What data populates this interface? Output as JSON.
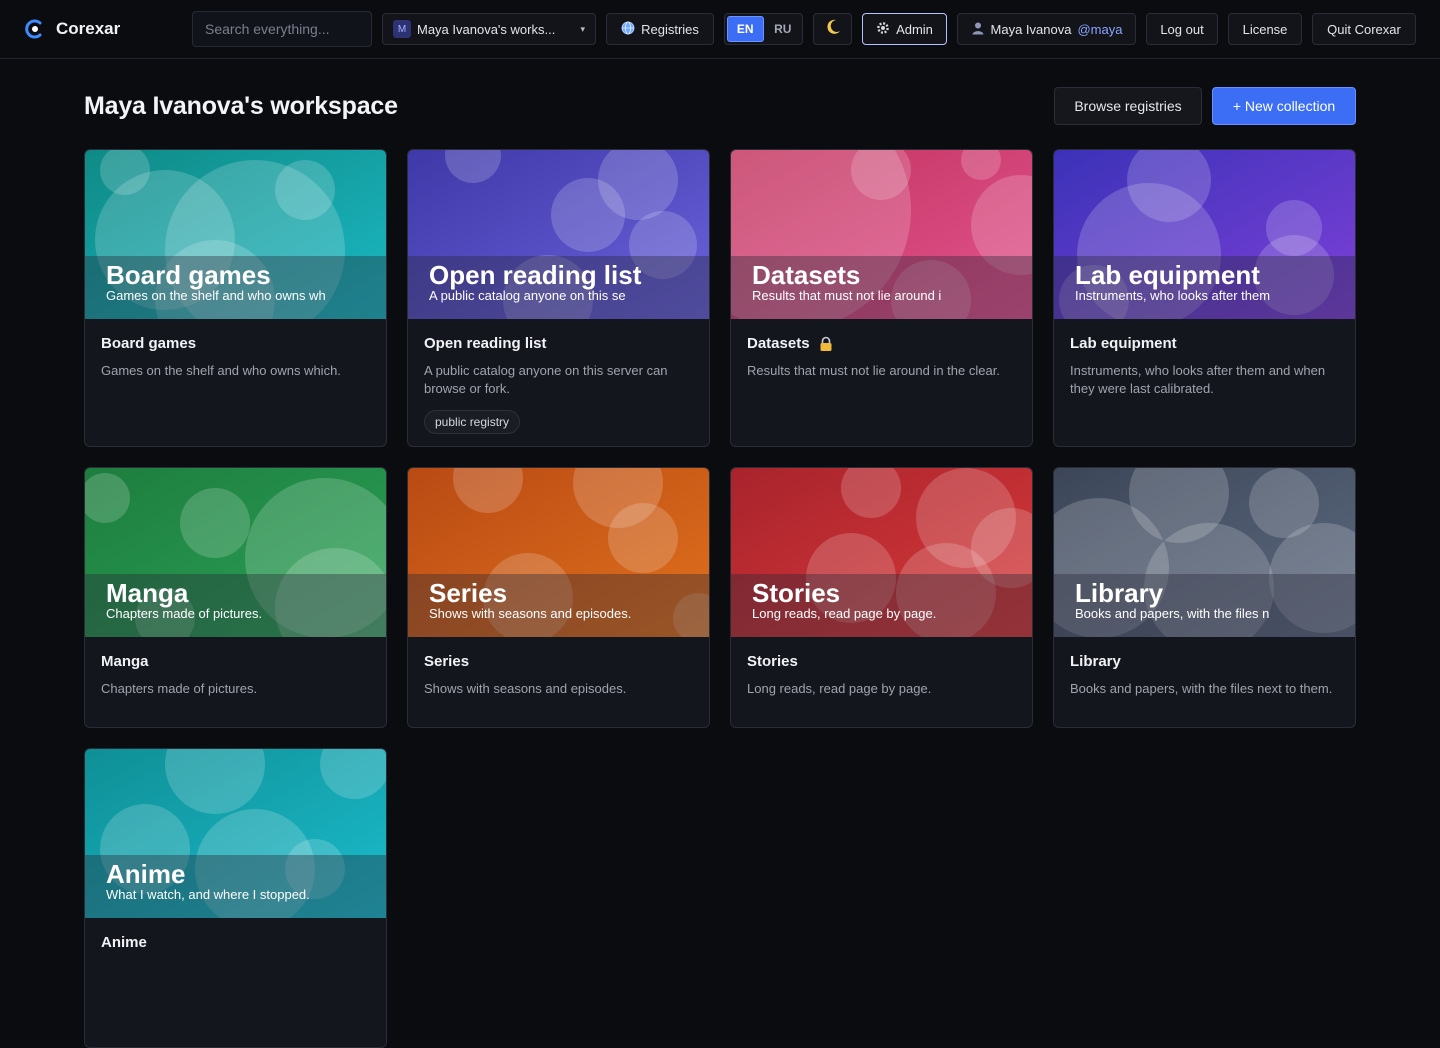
{
  "app": {
    "name": "Corexar"
  },
  "header": {
    "search_placeholder": "Search everything...",
    "workspace": {
      "avatar_letter": "M",
      "label": "Maya Ivanova's works..."
    },
    "registries_label": "Registries",
    "languages": [
      {
        "code": "EN",
        "active": true
      },
      {
        "code": "RU",
        "active": false
      }
    ],
    "theme_icon": "moon-icon",
    "admin_label": "Admin",
    "user": {
      "name": "Maya Ivanova",
      "handle": "@maya"
    },
    "logout_label": "Log out",
    "license_label": "License",
    "quit_label": "Quit Corexar"
  },
  "page": {
    "title": "Maya Ivanova's workspace",
    "browse_label": "Browse registries",
    "new_label": "+ New collection"
  },
  "collections": [
    {
      "title": "Board games",
      "banner_sub": "Games on the shelf and who owns wh",
      "description": "Games on the shelf and who owns which.",
      "tag": "",
      "locked": false,
      "colors": [
        "#0f8a86",
        "#1bb9c4"
      ]
    },
    {
      "title": "Open reading list",
      "banner_sub": "A public catalog anyone on this se",
      "description": "A public catalog anyone on this server can browse or fork.",
      "tag": "public registry",
      "locked": false,
      "colors": [
        "#3f38a8",
        "#6a63dc"
      ]
    },
    {
      "title": "Datasets",
      "banner_sub": "Results that must not lie around i",
      "description": "Results that must not lie around in the clear.",
      "tag": "",
      "locked": true,
      "colors": [
        "#c2335e",
        "#e2548f"
      ]
    },
    {
      "title": "Lab equipment",
      "banner_sub": "Instruments, who looks after them",
      "description": "Instruments, who looks after them and when they were last calibrated.",
      "tag": "",
      "locked": false,
      "colors": [
        "#3b32b8",
        "#7e40d8"
      ]
    },
    {
      "title": "Manga",
      "banner_sub": "Chapters made of pictures.",
      "description": "Chapters made of pictures.",
      "tag": "",
      "locked": false,
      "colors": [
        "#1e7d3e",
        "#2aa257"
      ]
    },
    {
      "title": "Series",
      "banner_sub": "Shows with seasons and episodes.",
      "description": "Shows with seasons and episodes.",
      "tag": "",
      "locked": false,
      "colors": [
        "#b94a14",
        "#e0711d"
      ]
    },
    {
      "title": "Stories",
      "banner_sub": "Long reads, read page by page.",
      "description": "Long reads, read page by page.",
      "tag": "",
      "locked": false,
      "colors": [
        "#a9232c",
        "#d83a3a"
      ]
    },
    {
      "title": "Library",
      "banner_sub": "Books and papers, with the files n",
      "description": "Books and papers, with the files next to them.",
      "tag": "",
      "locked": false,
      "colors": [
        "#3c4658",
        "#5d6a80"
      ]
    },
    {
      "title": "Anime",
      "banner_sub": "What I watch, and where I stopped.",
      "description": "",
      "tag": "",
      "locked": false,
      "colors": [
        "#0f8f96",
        "#1bbccc"
      ]
    }
  ]
}
